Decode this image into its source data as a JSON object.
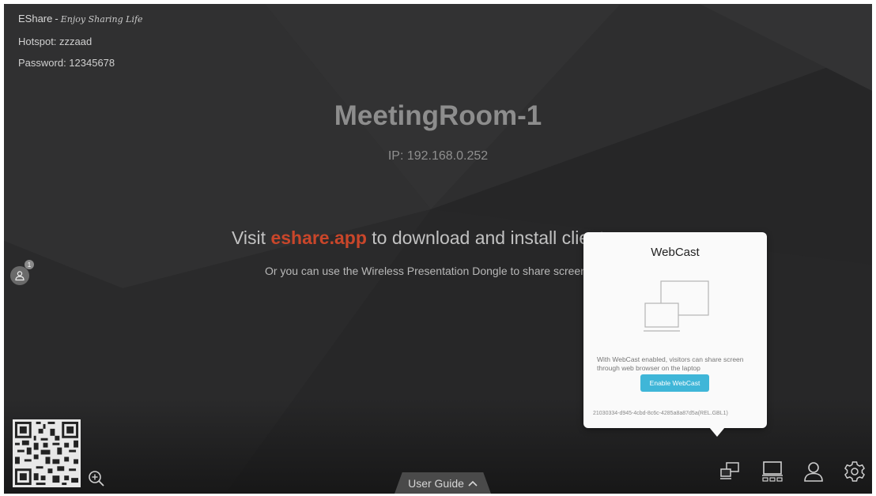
{
  "header": {
    "brand": "EShare",
    "separator": "-",
    "tagline": "Enjoy Sharing Life",
    "hotspot": "Hotspot: zzzaad",
    "password": "Password: 12345678"
  },
  "main": {
    "room_name": "MeetingRoom-1",
    "ip": "IP: 192.168.0.252",
    "visit_prefix": "Visit",
    "visit_link": "eshare.app",
    "visit_suffix": "to download and install client apps",
    "alt_text": "Or you can use the Wireless Presentation Dongle to share screen"
  },
  "users": {
    "count": "1",
    "icon": "user-icon"
  },
  "footer": {
    "user_guide_label": "User Guide",
    "user_guide_icon": "chevron-up-icon",
    "icons": [
      "qr-code",
      "zoom-in-icon",
      "webcast-icon",
      "screen-share-icon",
      "user-icon",
      "gear-icon"
    ]
  },
  "webcast_popup": {
    "title": "WebCast",
    "description": "With WebCast enabled, visitors can share screen through web browser on the laptop",
    "button_label": "Enable WebCast",
    "device_id": "21030334-d945-4cbd-8c6c-4285a8a87d5a(REL.GBL1)"
  },
  "colors": {
    "background": "#2c2c2d",
    "link_accent": "#c9462a",
    "button": "#3fb6d8",
    "popup_bg": "#fafafa"
  }
}
